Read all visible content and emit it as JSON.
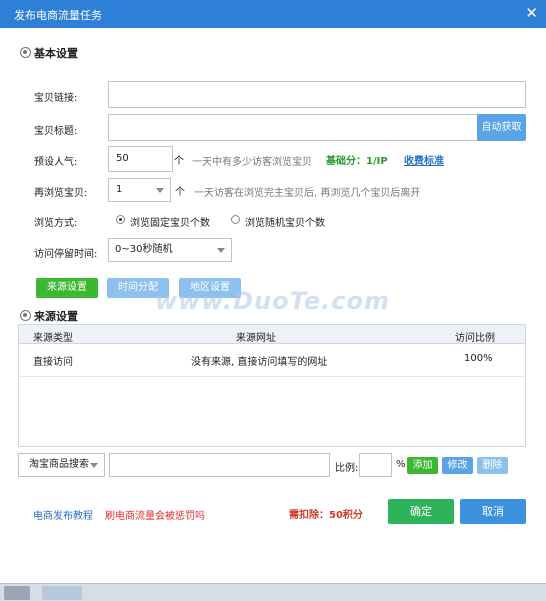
{
  "window": {
    "title": "发布电商流量任务",
    "close_label": "✕"
  },
  "basic": {
    "section_title": "基本设置",
    "link_label": "宝贝链接:",
    "link_value": "",
    "title_label": "宝贝标题:",
    "title_value": "",
    "auto_fetch": "自动获取",
    "popularity_label": "预设人气:",
    "popularity_value": "50",
    "popularity_unit": "个",
    "popularity_hint": "一天中有多少访客浏览宝贝",
    "base_score": "基础分：1/IP",
    "fee_link": "收费标准",
    "rebrowse_label": "再浏览宝贝:",
    "rebrowse_value": "1",
    "rebrowse_unit": "个",
    "rebrowse_hint": "一天访客在浏览完主宝贝后, 再浏览几个宝贝后离开",
    "browse_mode_label": "浏览方式:",
    "browse_mode_opt1": "浏览固定宝贝个数",
    "browse_mode_opt2": "浏览随机宝贝个数",
    "stay_label": "访问停留时间:",
    "stay_value": "0~30秒随机"
  },
  "tabs": {
    "source": "来源设置",
    "time": "时间分配",
    "region": "地区设置"
  },
  "source": {
    "section_title": "来源设置",
    "columns": [
      "来源类型",
      "来源网址",
      "访问比例"
    ],
    "rows": [
      {
        "type": "直接访问",
        "url": "没有来源, 直接访问填写的网址",
        "ratio": "100%"
      }
    ],
    "select_value": "淘宝商品搜索",
    "input_value": "",
    "ratio_label": "比例:",
    "ratio_value": "",
    "percent": "%",
    "add": "添加",
    "edit": "修改",
    "delete": "删除"
  },
  "footer": {
    "tutorial_link": "电商发布教程",
    "penalty_link": "刷电商流量会被惩罚吗",
    "deduct": "需扣除：50积分",
    "confirm": "确定",
    "cancel": "取消"
  },
  "watermark": "www.DuoTe.com",
  "colors": {
    "titlebar": "#2e7fd6",
    "green": "#3cb830",
    "blue": "#5aa3e6"
  }
}
